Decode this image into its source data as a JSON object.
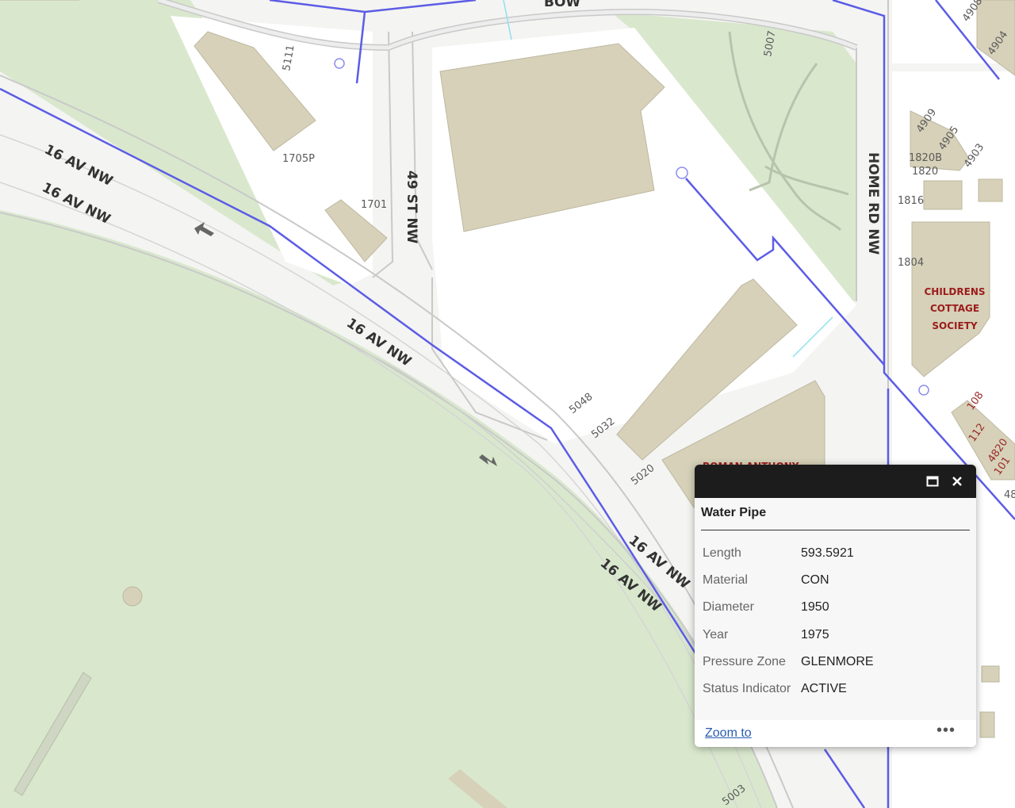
{
  "map": {
    "road_labels": {
      "ave16_a": "16 AV NW",
      "ave16_b": "16 AV NW",
      "ave16_c": "16 AV NW",
      "ave16_d": "16 AV NW",
      "ave16_e": "16 AV NW",
      "st49": "49 ST NW",
      "home_rd": "HOME RD NW",
      "bow_partial": "BOW"
    },
    "addresses": {
      "a5111": "5111",
      "a1705p": "1705P",
      "a1701": "1701",
      "a5007": "5007",
      "a5048": "5048",
      "a5032": "5032",
      "a5020": "5020",
      "a4909": "4909",
      "a4905": "4905",
      "a4903": "4903",
      "a4908": "4908",
      "a4904": "4904",
      "a1820b": "1820B",
      "a1820": "1820",
      "a1816": "1816",
      "a1804": "1804",
      "a108": "108",
      "a112": "112",
      "a4820": "4820",
      "a101": "101",
      "a48": "48",
      "a5003": "5003"
    },
    "poi": {
      "line1": "CHILDRENS",
      "line2": "COTTAGE",
      "line3": "SOCIETY",
      "roman": "ROMAN ANTHONY"
    },
    "colors": {
      "park": "#d9e8cd",
      "building": "#d6d1b8",
      "water_pipe": "#5c5ce6",
      "road_edge": "#c9c9c9"
    }
  },
  "popup": {
    "title": "Water Pipe",
    "maximize_icon": "maximize-icon",
    "close_icon": "close-icon",
    "attributes": [
      {
        "name": "Length",
        "value": "593.5921"
      },
      {
        "name": "Material",
        "value": "CON"
      },
      {
        "name": "Diameter",
        "value": "1950"
      },
      {
        "name": "Year",
        "value": "1975"
      },
      {
        "name": "Pressure Zone",
        "value": "GLENMORE"
      },
      {
        "name": "Status Indicator",
        "value": "ACTIVE"
      }
    ],
    "zoom_to": "Zoom to",
    "more_label": "•••"
  }
}
